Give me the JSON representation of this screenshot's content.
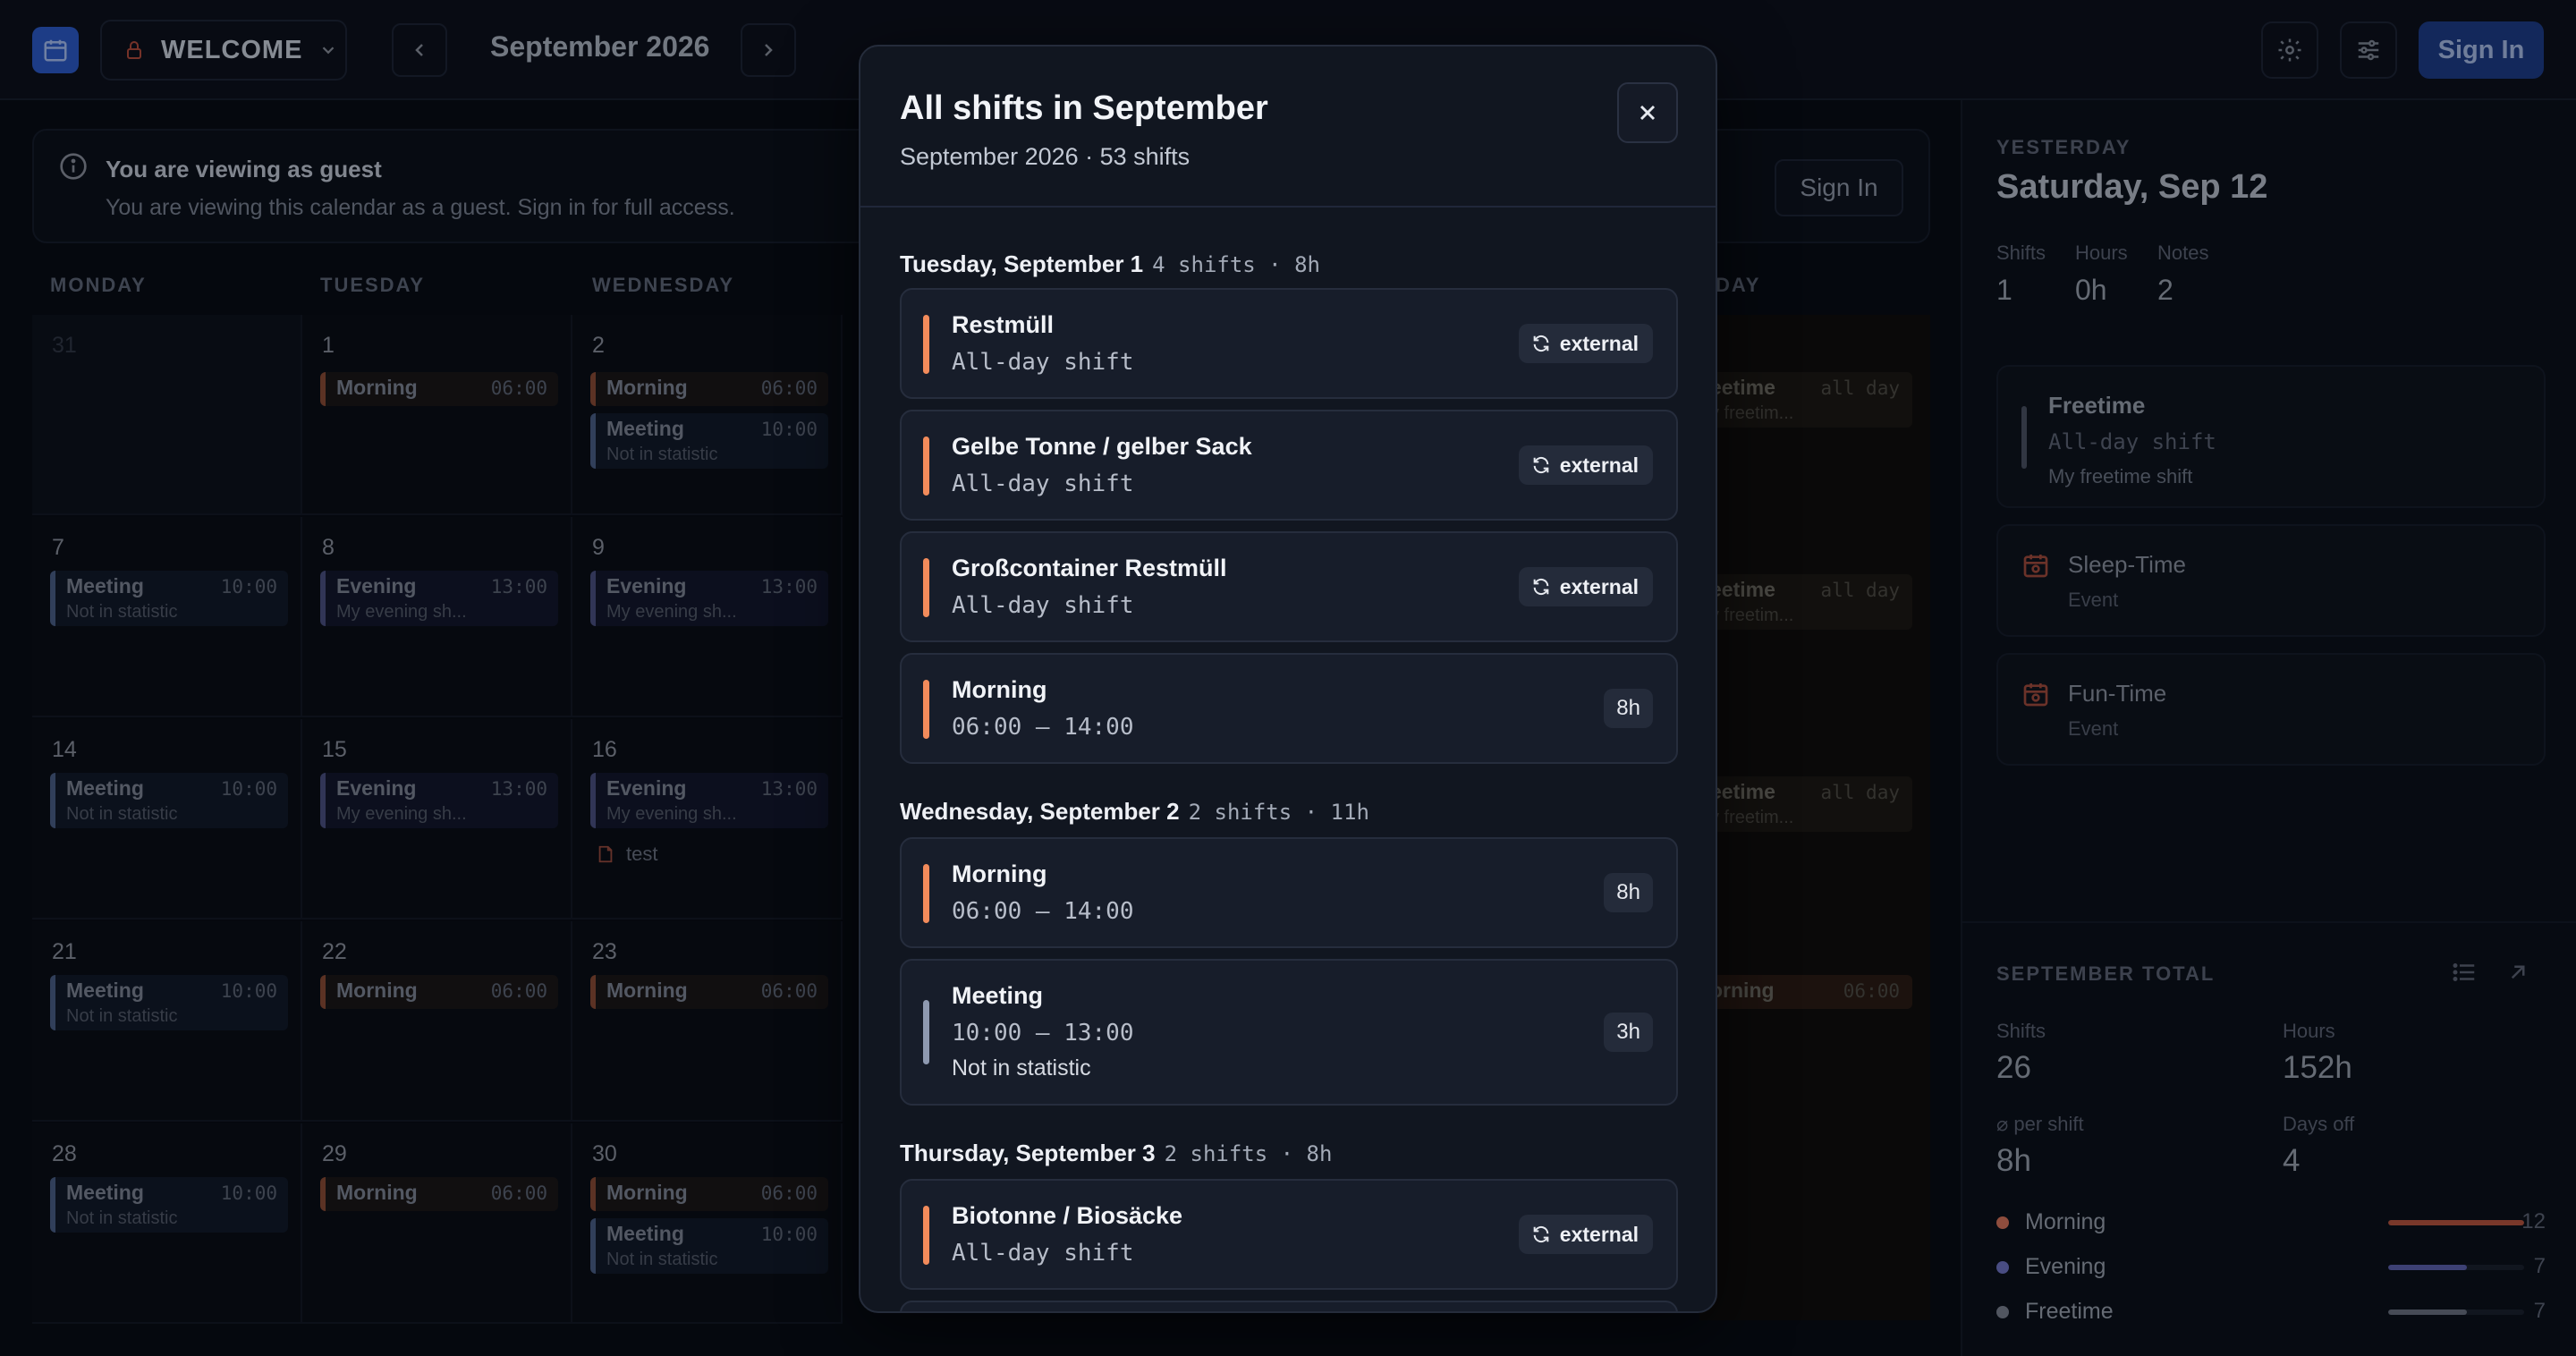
{
  "topbar": {
    "workspace_label": "WELCOME",
    "month_label": "September 2026",
    "signin_label": "Sign In"
  },
  "banner": {
    "title": "You are viewing as guest",
    "text": "You are viewing this calendar as a guest. Sign in for full access.",
    "signin_label": "Sign In"
  },
  "calendar": {
    "weekdays": [
      "MONDAY",
      "TUESDAY",
      "WEDNESDAY"
    ],
    "right_header_fragment": "DAY",
    "cells": {
      "c31": "31",
      "c1": "1",
      "c2": "2",
      "c7": "7",
      "c8": "8",
      "c9": "9",
      "c14": "14",
      "c15": "15",
      "c16": "16",
      "c21": "21",
      "c22": "22",
      "c23": "23",
      "c28": "28",
      "c29": "29",
      "c30": "30"
    },
    "chips": {
      "morning": "Morning",
      "morning_time": "06:00",
      "meeting": "Meeting",
      "meeting_time": "10:00",
      "meeting_sub": "Not in statistic",
      "evening": "Evening",
      "evening_time": "13:00",
      "evening_sub": "My evening sh..."
    },
    "note_test": "test",
    "right_chips": {
      "freetime_name": "eetime",
      "freetime_time": "all day",
      "freetime_sub": "y freetim...",
      "morning_name": "orning",
      "morning_time": "06:00"
    }
  },
  "sidebar": {
    "yesterday_label": "YESTERDAY",
    "date": "Saturday, Sep 12",
    "stats": [
      {
        "label": "Shifts",
        "value": "1"
      },
      {
        "label": "Hours",
        "value": "0h"
      },
      {
        "label": "Notes",
        "value": "2"
      }
    ],
    "freetime_card": {
      "title": "Freetime",
      "sub": "All-day shift",
      "note": "My freetime shift"
    },
    "events": [
      {
        "title": "Sleep-Time",
        "sub": "Event"
      },
      {
        "title": "Fun-Time",
        "sub": "Event"
      }
    ],
    "total_label": "SEPTEMBER TOTAL",
    "totals": [
      {
        "label": "Shifts",
        "value": "26"
      },
      {
        "label": "Hours",
        "value": "152h"
      },
      {
        "label": "⌀ per shift",
        "value": "8h"
      },
      {
        "label": "Days off",
        "value": "4"
      }
    ],
    "breakdown": [
      {
        "label": "Morning",
        "value": "12",
        "fraction": 1.0,
        "color": "#d9735a",
        "bar_color": "#b8543d"
      },
      {
        "label": "Evening",
        "value": "7",
        "fraction": 0.58,
        "color": "#6f73c4",
        "bar_color": "#5d62ae"
      },
      {
        "label": "Freetime",
        "value": "7",
        "fraction": 0.58,
        "color": "#7b8190",
        "bar_color": "#6b7180"
      }
    ]
  },
  "modal": {
    "title": "All shifts in September",
    "subtitle": "September 2026 · 53 shifts",
    "external_label": "external",
    "days": [
      {
        "heading": "Tuesday, September 1",
        "meta": "4 shifts · 8h",
        "shifts": [
          {
            "name": "Restmüll",
            "sub": "All-day shift",
            "badge": "external"
          },
          {
            "name": "Gelbe Tonne / gelber Sack",
            "sub": "All-day shift",
            "badge": "external"
          },
          {
            "name": "Großcontainer Restmüll",
            "sub": "All-day shift",
            "badge": "external"
          },
          {
            "name": "Morning",
            "sub": "06:00 – 14:00",
            "badge": "8h"
          }
        ]
      },
      {
        "heading": "Wednesday, September 2",
        "meta": "2 shifts · 11h",
        "shifts": [
          {
            "name": "Morning",
            "sub": "06:00 – 14:00",
            "badge": "8h"
          },
          {
            "name": "Meeting",
            "sub": "10:00 – 13:00",
            "note": "Not in statistic",
            "badge": "3h"
          }
        ]
      },
      {
        "heading": "Thursday, September 3",
        "meta": "2 shifts · 8h",
        "shifts": [
          {
            "name": "Biotonne / Biosäcke",
            "sub": "All-day shift",
            "badge": "external"
          }
        ]
      }
    ]
  },
  "colors": {
    "accent_orange": "#f28b5b",
    "accent_slate": "#8e99b0",
    "primary_blue": "#2c59c9"
  }
}
